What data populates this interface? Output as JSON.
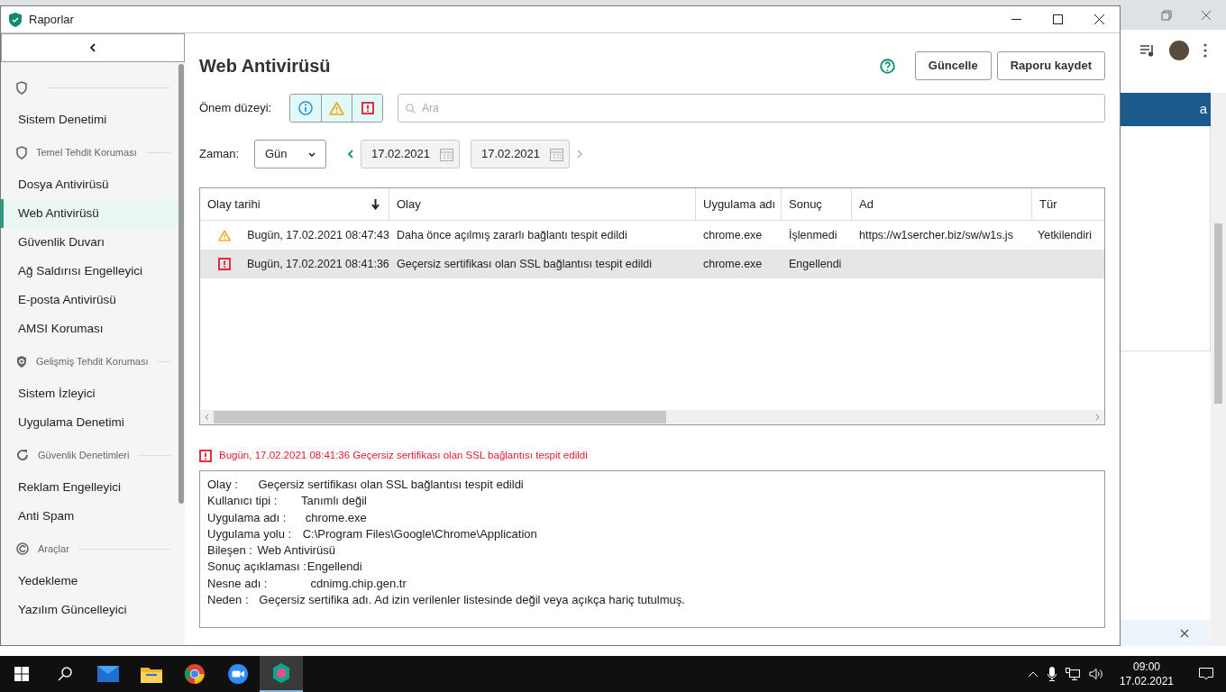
{
  "app_window": {
    "title": "Raporlar"
  },
  "sidebar": {
    "sections": [
      {
        "items": [
          {
            "label": "Sistem Denetimi",
            "selected": false
          }
        ]
      },
      {
        "title": "Temel Tehdit Koruması",
        "items": [
          {
            "label": "Dosya Antivirüsü",
            "selected": false
          },
          {
            "label": "Web Antivirüsü",
            "selected": true
          },
          {
            "label": "Güvenlik Duvarı",
            "selected": false
          },
          {
            "label": "Ağ Saldırısı Engelleyici",
            "selected": false
          },
          {
            "label": "E-posta Antivirüsü",
            "selected": false
          },
          {
            "label": "AMSI Koruması",
            "selected": false
          }
        ]
      },
      {
        "title": "Gelişmiş Tehdit Koruması",
        "items": [
          {
            "label": "Sistem İzleyici",
            "selected": false
          },
          {
            "label": "Uygulama Denetimi",
            "selected": false
          }
        ]
      },
      {
        "title": "Güvenlik Denetimleri",
        "items": [
          {
            "label": "Reklam Engelleyici",
            "selected": false
          },
          {
            "label": "Anti Spam",
            "selected": false
          }
        ]
      },
      {
        "title": "Araçlar",
        "items": [
          {
            "label": "Yedekleme",
            "selected": false
          },
          {
            "label": "Yazılım Güncelleyici",
            "selected": false
          }
        ]
      }
    ]
  },
  "main": {
    "title": "Web Antivirüsü",
    "buttons": [
      "Güncelle",
      "Raporu kaydet"
    ],
    "severity_filter": {
      "label": "Önem düzeyi:",
      "levels": [
        {
          "kind": "info",
          "selected": true
        },
        {
          "kind": "warning",
          "selected": true
        },
        {
          "kind": "error",
          "selected": true
        }
      ]
    },
    "search": {
      "placeholder": "Ara"
    },
    "time": {
      "label": "Zaman:",
      "period": "Gün",
      "date_from": "17.02.2021",
      "date_to": "17.02.2021",
      "next_disabled": true
    }
  },
  "table": {
    "columns": [
      {
        "label": "Olay tarihi",
        "sorted": true
      },
      {
        "label": "Olay",
        "sorted": false
      },
      {
        "label": "Uygulama adı",
        "sorted": false
      },
      {
        "label": "Sonuç",
        "sorted": false
      },
      {
        "label": "Ad",
        "sorted": false
      },
      {
        "label": "Tür",
        "sorted": false
      }
    ],
    "rows": [
      {
        "kind": "warning",
        "selected": false,
        "cells": [
          "Bugün, 17.02.2021 08:47:43",
          "Daha önce açılmış zararlı bağlantı tespit edildi",
          "chrome.exe",
          "İşlenmedi",
          "https://w1sercher.biz/sw/w1s.js",
          "Yetkilendiri"
        ]
      },
      {
        "kind": "error",
        "selected": true,
        "cells": [
          "Bugün, 17.02.2021 08:41:36",
          "Geçersiz sertifikası olan SSL bağlantısı tespit edildi",
          "chrome.exe",
          "Engellendi",
          "",
          ""
        ]
      }
    ]
  },
  "details": {
    "kind": "error",
    "heading": "Bugün, 17.02.2021 08:41:36 Geçersiz sertifikası olan SSL bağlantısı tespit edildi",
    "lines": [
      {
        "label": "Olay :",
        "value": "Geçersiz sertifikası olan SSL bağlantısı tespit edildi"
      },
      {
        "label": "Kullanıcı tipi :",
        "value": "Tanımlı değil"
      },
      {
        "label": "Uygulama adı :",
        "value": "chrome.exe"
      },
      {
        "label": "Uygulama yolu :",
        "value": "C:\\Program Files\\Google\\Chrome\\Application"
      },
      {
        "label": "Bileşen :",
        "value": "Web Antivirüsü"
      },
      {
        "label": "Sonuç açıklaması :",
        "value": "Engellendi"
      },
      {
        "label": "Nesne adı :",
        "value": "cdnimg.chip.gen.tr"
      },
      {
        "label": "Neden :",
        "value": "Geçersiz sertifika adı. Ad izin verilenler listesinde değil veya açıkça hariç tutulmuş."
      }
    ]
  },
  "background_window": {
    "banner_text": "a"
  },
  "taskbar": {
    "apps": [
      {
        "kind": "mail",
        "active": false
      },
      {
        "kind": "folder",
        "active": false
      },
      {
        "kind": "browser",
        "active": false
      },
      {
        "kind": "video",
        "active": false
      },
      {
        "kind": "shield",
        "active": true
      }
    ],
    "clock": {
      "time": "09:00",
      "date": "17.02.2021"
    }
  }
}
